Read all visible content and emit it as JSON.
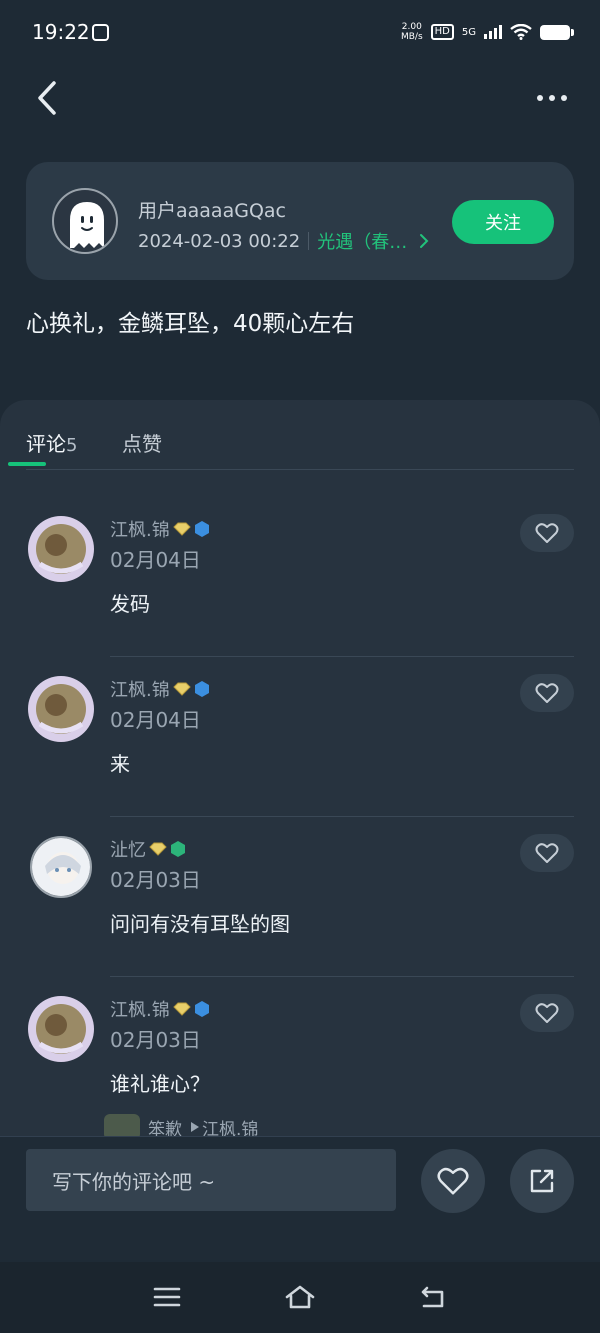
{
  "status_bar": {
    "time": "19:22",
    "speed_value": "2.00",
    "speed_unit": "MB/s",
    "hd": "HD",
    "network": "5G",
    "icons": [
      "gallery-icon",
      "hd-icon",
      "signal-icon",
      "wifi-icon",
      "battery-icon"
    ]
  },
  "nav": {
    "back_icon": "chevron-left-icon",
    "more_icon": "more-horizontal-icon"
  },
  "author": {
    "name": "用户aaaaaGQac",
    "datetime": "2024-02-03 00:22",
    "game": "光遇（春…",
    "follow_label": "关注",
    "avatar_icon": "ghost-avatar-icon",
    "accent": "#16c27a"
  },
  "post": {
    "text": "心换礼，金鳞耳坠，40颗心左右"
  },
  "tabs": {
    "comments_label": "评论",
    "comments_count": "5",
    "likes_label": "点赞"
  },
  "comments": [
    {
      "user": "江枫.锦",
      "date": "02月04日",
      "text": "发码",
      "badges": [
        "diamond-badge-icon",
        "blue-hex-badge-icon"
      ]
    },
    {
      "user": "江枫.锦",
      "date": "02月04日",
      "text": "来",
      "badges": [
        "diamond-badge-icon",
        "blue-hex-badge-icon"
      ]
    },
    {
      "user": "沚忆",
      "date": "02月03日",
      "text": "问问有没有耳坠的图",
      "badges": [
        "diamond-badge-icon",
        "green-hex-badge-icon"
      ]
    },
    {
      "user": "江枫.锦",
      "date": "02月03日",
      "text": "谁礼谁心？",
      "badges": [
        "diamond-badge-icon",
        "blue-hex-badge-icon"
      ]
    }
  ],
  "reply_peek": {
    "from": "笨歉",
    "to": "江枫.锦"
  },
  "bottom": {
    "input_placeholder": "写下你的评论吧 ~",
    "like_icon": "heart-icon",
    "share_icon": "share-icon"
  },
  "system_nav": {
    "icons": [
      "menu-icon",
      "home-icon",
      "back-icon"
    ]
  }
}
